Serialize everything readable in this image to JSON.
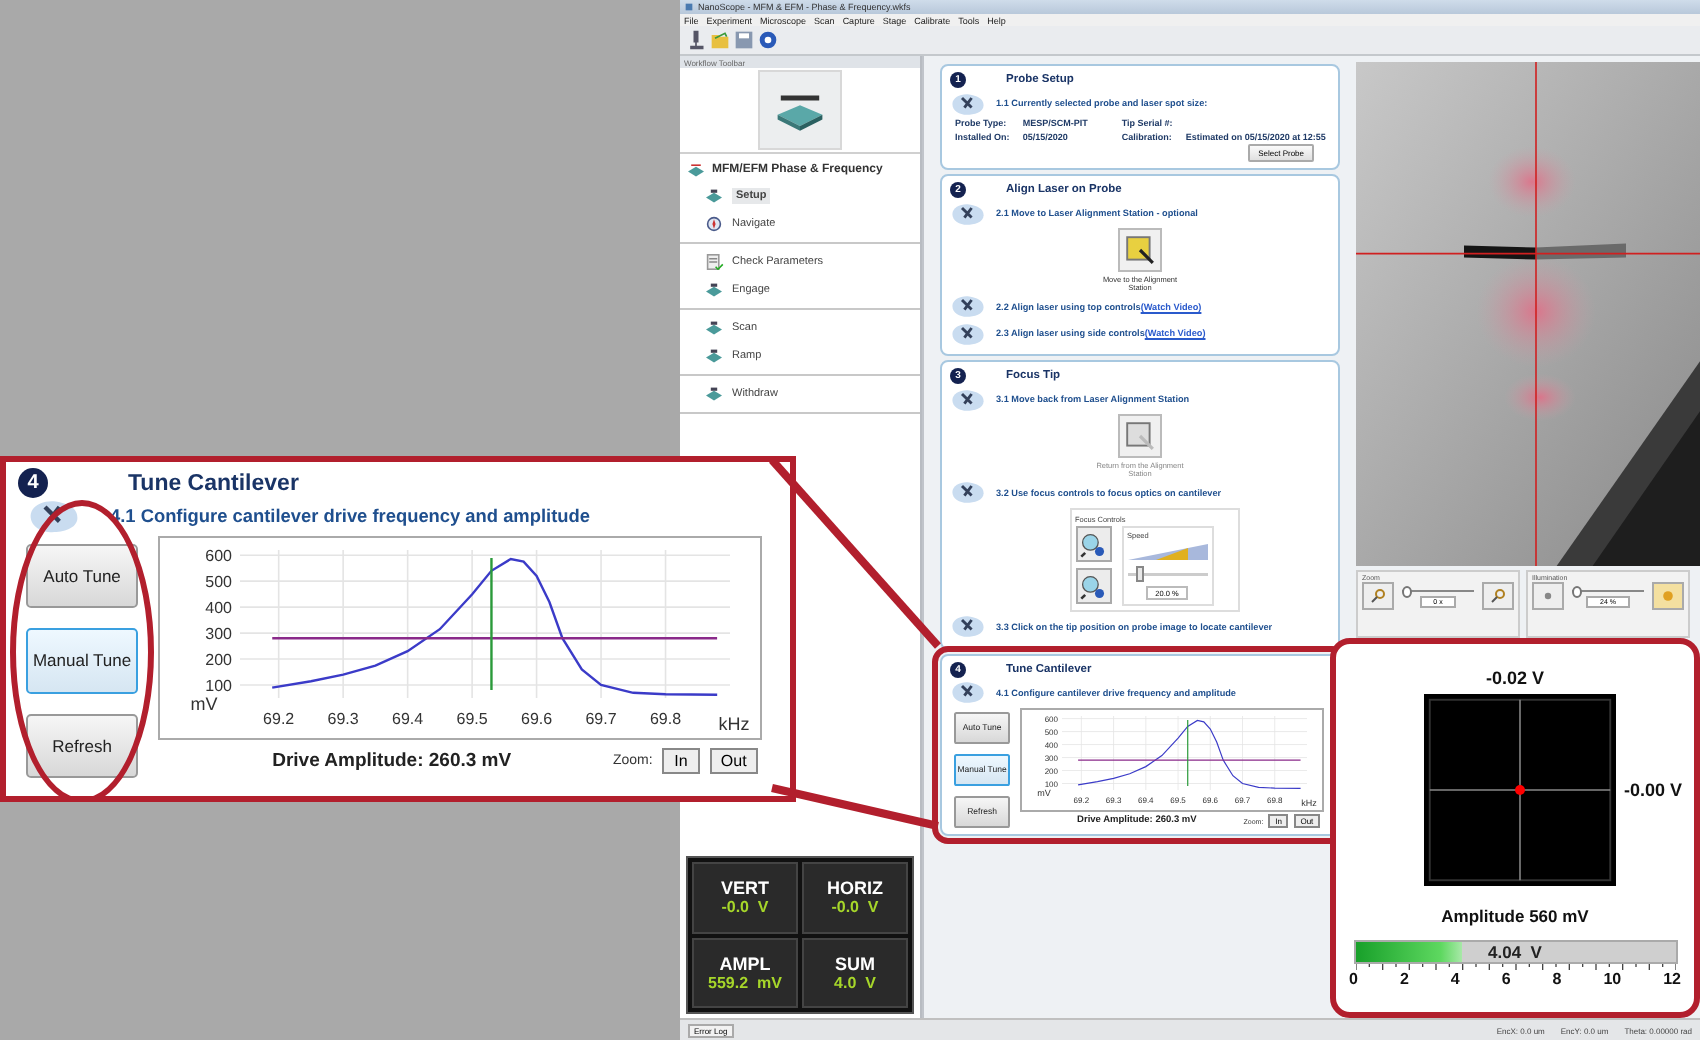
{
  "title_bar": {
    "title": "NanoScope - MFM & EFM - Phase & Frequency.wkfs"
  },
  "menu": [
    "File",
    "Experiment",
    "Microscope",
    "Scan",
    "Capture",
    "Stage",
    "Calibrate",
    "Tools",
    "Help"
  ],
  "workflow": {
    "title": "Workflow Toolbar",
    "mode": "MFM/EFM Phase & Frequency",
    "groups": [
      {
        "items": [
          {
            "label": "Setup",
            "selected": true
          },
          {
            "label": "Navigate",
            "selected": false
          }
        ]
      },
      {
        "items": [
          {
            "label": "Check Parameters",
            "selected": false
          },
          {
            "label": "Engage",
            "selected": false
          }
        ]
      },
      {
        "items": [
          {
            "label": "Scan",
            "selected": false
          },
          {
            "label": "Ramp",
            "selected": false
          }
        ]
      },
      {
        "items": [
          {
            "label": "Withdraw",
            "selected": false
          }
        ]
      }
    ]
  },
  "readouts": [
    {
      "label": "VERT",
      "value": "-0.0  V"
    },
    {
      "label": "HORIZ",
      "value": "-0.0  V"
    },
    {
      "label": "AMPL",
      "value": "559.2  mV"
    },
    {
      "label": "SUM",
      "value": "4.0  V"
    }
  ],
  "steps": [
    {
      "number": "1",
      "title": "Probe Setup",
      "highlighted": false,
      "items": [
        {
          "kind": "instruction",
          "text": "1.1 Currently selected probe and laser spot size:"
        },
        {
          "kind": "probe_info",
          "fields": [
            {
              "label": "Probe Type:",
              "value": "MESP/SCM-PIT"
            },
            {
              "label": "Tip Serial #:"
            },
            {
              "label": "Installed On:",
              "value": "05/15/2020"
            },
            {
              "label": "Calibration:",
              "value": "Estimated on 05/15/2020 at 12:55"
            }
          ],
          "button": "Select Probe"
        }
      ]
    },
    {
      "number": "2",
      "title": "Align Laser on Probe",
      "highlighted": false,
      "items": [
        {
          "kind": "instruction",
          "text": "2.1 Move to Laser Alignment Station - optional"
        },
        {
          "kind": "station_button",
          "caption": "Move to the Alignment Station",
          "disabled": false
        },
        {
          "kind": "instruction",
          "text": "2.2 Align laser using top controls",
          "link": "(Watch Video)"
        },
        {
          "kind": "instruction",
          "text": "2.3 Align laser using side controls",
          "link": "(Watch Video)"
        }
      ]
    },
    {
      "number": "3",
      "title": "Focus Tip",
      "highlighted": false,
      "items": [
        {
          "kind": "instruction",
          "text": "3.1 Move back from Laser Alignment Station"
        },
        {
          "kind": "station_button",
          "caption": "Return from the Alignment Station",
          "disabled": true
        },
        {
          "kind": "instruction",
          "text": "3.2 Use focus controls to focus optics on cantilever"
        },
        {
          "kind": "focus",
          "title": "Focus Controls",
          "speed_label": "Speed",
          "speed_value": "20.0 %",
          "level": 0.1
        },
        {
          "kind": "instruction",
          "text": "3.3 Click on the tip position on probe image to locate cantilever"
        }
      ]
    },
    {
      "number": "4",
      "title": "Tune Cantilever",
      "highlighted": true,
      "items": [
        {
          "kind": "instruction",
          "text": "4.1 Configure cantilever drive frequency and amplitude"
        },
        {
          "kind": "tune",
          "buttons": [
            {
              "label": "Auto Tune",
              "selected": false
            },
            {
              "label": "Manual Tune",
              "selected": true
            },
            {
              "label": "Refresh",
              "selected": false
            }
          ],
          "chart_data": {
            "type": "line",
            "xlabel": "kHz",
            "ylabel": "mV",
            "x": [
              69.19,
              69.25,
              69.3,
              69.35,
              69.4,
              69.45,
              69.5,
              69.53,
              69.56,
              69.58,
              69.6,
              69.62,
              69.64,
              69.67,
              69.7,
              69.75,
              69.8,
              69.88
            ],
            "series": [
              {
                "color": "#3b3bc8",
                "values": [
                  90,
                  115,
                  140,
                  175,
                  230,
                  315,
                  450,
                  540,
                  585,
                  575,
                  520,
                  420,
                  280,
                  160,
                  100,
                  70,
                  65,
                  62
                ]
              }
            ],
            "xlim": [
              69.14,
              69.9
            ],
            "ylim": [
              50,
              620
            ],
            "xticks": [
              69.2,
              69.3,
              69.4,
              69.5,
              69.6,
              69.7,
              69.8
            ],
            "yticks": [
              100,
              200,
              300,
              400,
              500,
              600
            ],
            "grid": true,
            "ref_lines": [
              {
                "axis": "y",
                "value": 280,
                "color": "#8a2a8a"
              },
              {
                "axis": "x",
                "value": 69.53,
                "color": "#2a9a3a"
              }
            ]
          },
          "drive": "Drive Amplitude: 260.3 mV",
          "zoom_label": "Zoom:",
          "zoom_buttons": [
            "In",
            "Out"
          ]
        }
      ]
    }
  ],
  "callout": {
    "number": "4",
    "title": "Tune Cantilever",
    "items": [
      {
        "kind": "instruction",
        "text": "4.1 Configure cantilever drive frequency and amplitude"
      },
      {
        "kind": "tune",
        "buttons": [
          {
            "label": "Auto Tune",
            "selected": false
          },
          {
            "label": "Manual Tune",
            "selected": true
          },
          {
            "label": "Refresh",
            "selected": false
          }
        ],
        "chart_data": {
          "type": "line",
          "xlabel": "kHz",
          "ylabel": "mV",
          "x": [
            69.19,
            69.25,
            69.3,
            69.35,
            69.4,
            69.45,
            69.5,
            69.53,
            69.56,
            69.58,
            69.6,
            69.62,
            69.64,
            69.67,
            69.7,
            69.75,
            69.8,
            69.88
          ],
          "series": [
            {
              "color": "#3b3bc8",
              "values": [
                90,
                115,
                140,
                175,
                230,
                315,
                450,
                540,
                585,
                575,
                520,
                420,
                280,
                160,
                100,
                70,
                65,
                62
              ]
            }
          ],
          "xlim": [
            69.14,
            69.9
          ],
          "ylim": [
            50,
            620
          ],
          "xticks": [
            69.2,
            69.3,
            69.4,
            69.5,
            69.6,
            69.7,
            69.8
          ],
          "yticks": [
            100,
            200,
            300,
            400,
            500,
            600
          ],
          "grid": true,
          "ref_lines": [
            {
              "axis": "y",
              "value": 280,
              "color": "#8a2a8a"
            },
            {
              "axis": "x",
              "value": 69.53,
              "color": "#2a9a3a"
            }
          ]
        },
        "drive": "Drive Amplitude: 260.3 mV",
        "zoom_label": "Zoom:",
        "zoom_buttons": [
          "In",
          "Out"
        ]
      }
    ]
  },
  "camera": {
    "zoom": {
      "label": "Zoom",
      "value": "0 x",
      "level": 0
    },
    "illumination": {
      "label": "Illumination",
      "value": "24 %",
      "level": 0
    }
  },
  "quadrant": {
    "top": "-0.02 V",
    "right": "-0.00 V",
    "amplitude": "Amplitude 560 mV",
    "bar": {
      "level": 0.337,
      "reading": "4.04  V",
      "ticks": [
        "0",
        "2",
        "4",
        "6",
        "8",
        "10",
        "12"
      ]
    }
  },
  "status_bar": {
    "tab": "Error Log",
    "fields": [
      "EncX: 0.0 um",
      "EncY: 0.0 um",
      "Theta: 0.00000 rad"
    ]
  }
}
